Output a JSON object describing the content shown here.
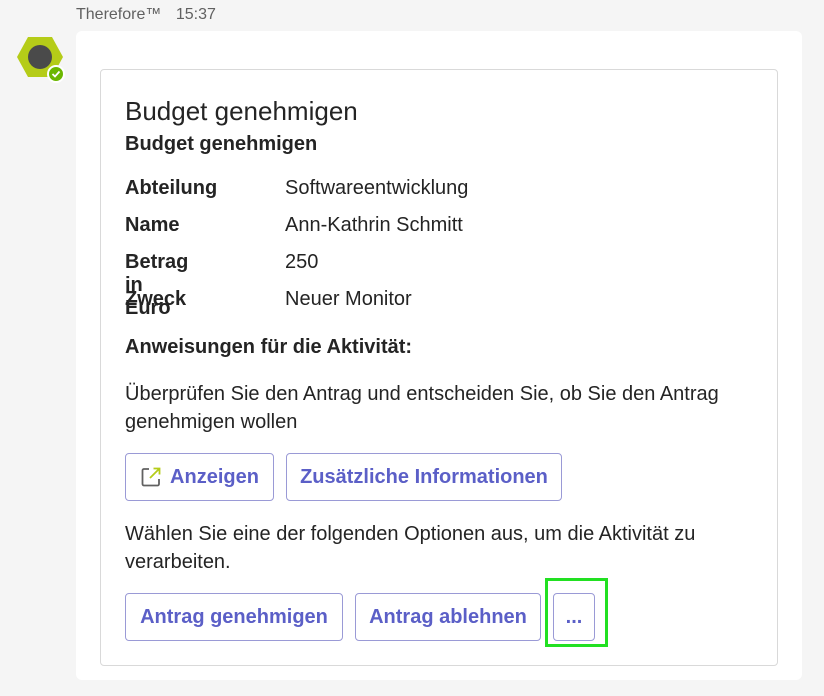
{
  "header": {
    "sender": "Therefore™",
    "time": "15:37"
  },
  "card": {
    "title": "Budget genehmigen",
    "subtitle": "Budget genehmigen",
    "facts": [
      {
        "label": "Abteilung",
        "value": "Softwareentwicklung"
      },
      {
        "label": "Name",
        "value": "Ann-Kathrin Schmitt"
      },
      {
        "label": "Betrag in Euro",
        "value": "250"
      },
      {
        "label": "Zweck",
        "value": "Neuer Monitor"
      }
    ],
    "instructions_heading": "Anweisungen für die Aktivität:",
    "instructions_text": "Überprüfen Sie den Antrag und entscheiden Sie, ob Sie den Antrag genehmigen wollen",
    "view_button": "Anzeigen",
    "info_button": "Zusätzliche Informationen",
    "choose_text": "Wählen Sie eine der folgenden Optionen aus, um die Aktivität zu verarbeiten.",
    "approve_button": "Antrag genehmigen",
    "reject_button": "Antrag ablehnen",
    "more_button": "..."
  },
  "colors": {
    "accent": "#5b5fc7",
    "avatar_hex": "#b5cc18",
    "status_green": "#6bb700",
    "focus_outline": "#22e022"
  },
  "icons": {
    "avatar": "hexagon-logo-icon",
    "status": "available-check-icon",
    "view": "open-external-icon"
  }
}
